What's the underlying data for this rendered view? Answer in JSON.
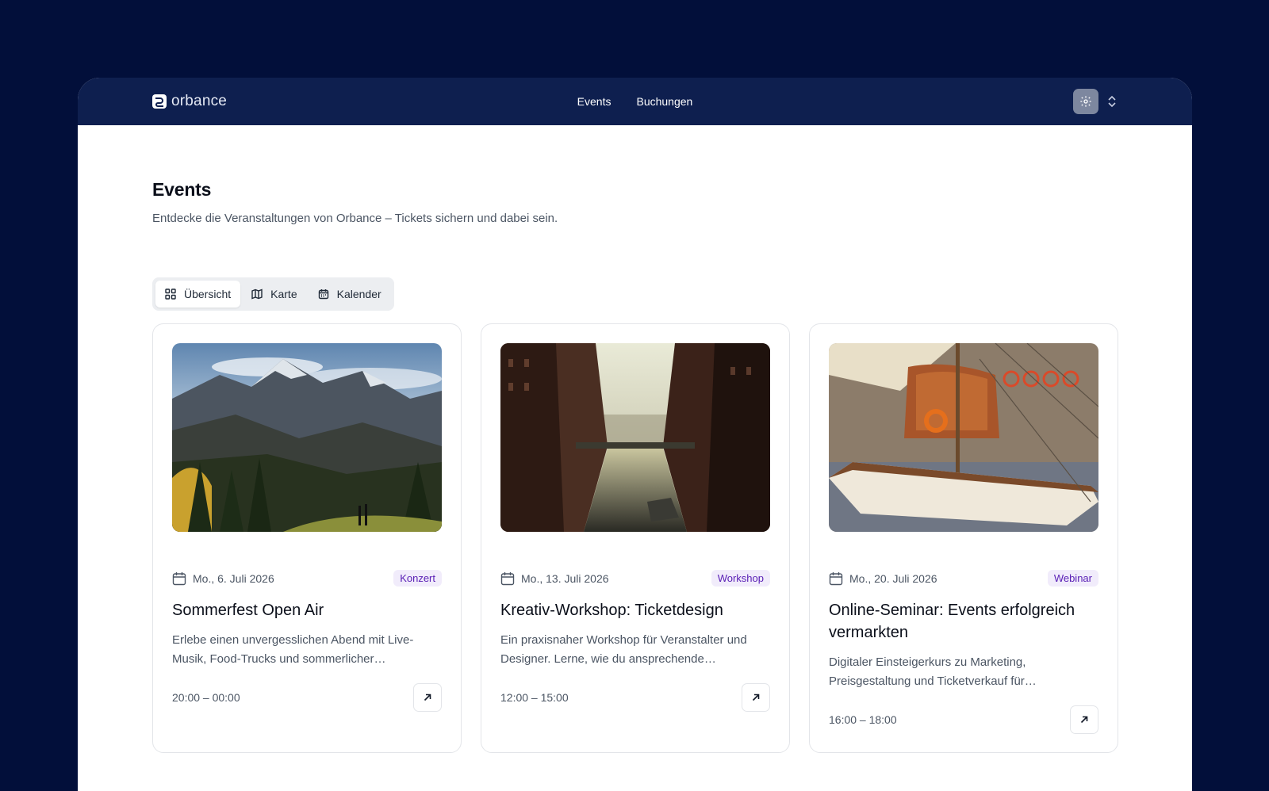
{
  "header": {
    "brand": "orbance",
    "nav": [
      "Events",
      "Buchungen"
    ]
  },
  "page": {
    "title": "Events",
    "subtitle": "Entdecke die Veranstaltungen von Orbance – Tickets sichern und dabei sein."
  },
  "views": {
    "overview": "Übersicht",
    "map": "Karte",
    "calendar": "Kalender"
  },
  "events": [
    {
      "date": "Mo., 6. Juli 2026",
      "category": "Konzert",
      "title": "Sommerfest Open Air",
      "description_line1": "Erlebe einen unvergesslichen Abend mit Live-",
      "description_line2": "Musik, Food-Trucks und sommerlicher…",
      "time": "20:00 – 00:00"
    },
    {
      "date": "Mo., 13. Juli 2026",
      "category": "Workshop",
      "title": "Kreativ-Workshop: Ticketdesign",
      "description_line1": "Ein praxisnaher Workshop für Veranstalter und",
      "description_line2": "Designer. Lerne, wie du ansprechende…",
      "time": "12:00 – 15:00"
    },
    {
      "date": "Mo., 20. Juli 2026",
      "category": "Webinar",
      "title_line1": "Online-Seminar: Events erfolgreich",
      "title_line2": "vermarkten",
      "description_line1": "Digitaler Einsteigerkurs zu Marketing,",
      "description_line2": "Preisgestaltung und Ticketverkauf für…",
      "time": "16:00 – 18:00"
    }
  ],
  "colors": {
    "page_background": "#020f3a",
    "topbar": "#0e1f4f",
    "badge_text": "#5b21b6",
    "badge_bg": "#f1ecfb"
  }
}
